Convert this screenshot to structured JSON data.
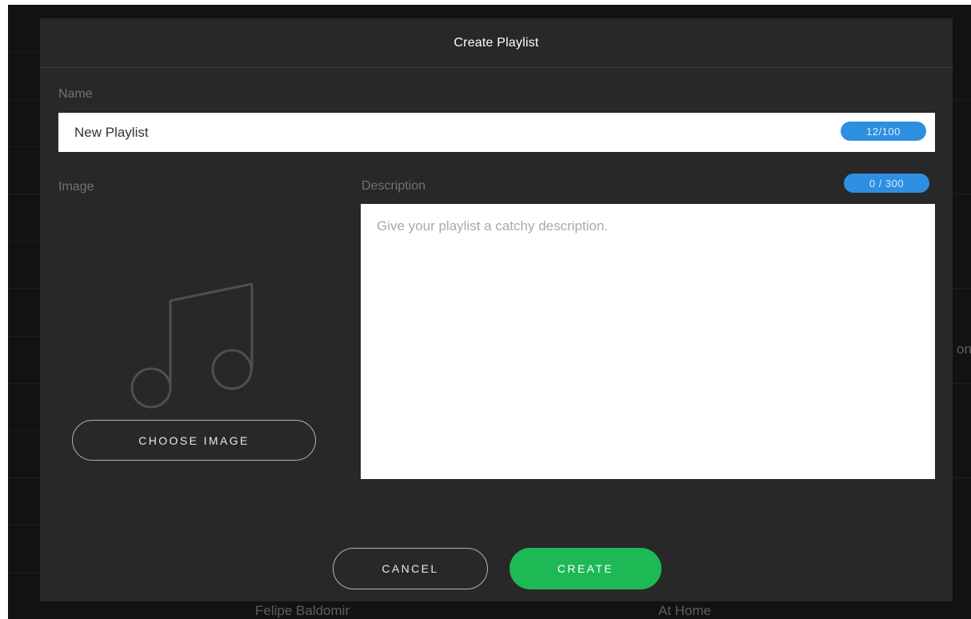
{
  "background": {
    "row_artist": "Felipe Baldomir",
    "row_album": "At Home",
    "edge_fragment": "on"
  },
  "dialog": {
    "title": "Create Playlist",
    "name": {
      "label": "Name",
      "value": "New Playlist",
      "counter": "12/100"
    },
    "image": {
      "label": "Image",
      "placeholder_icon": "music-note-icon",
      "choose_button": "CHOOSE IMAGE"
    },
    "description": {
      "label": "Description",
      "placeholder": "Give your playlist a catchy description.",
      "value": "",
      "counter": "0 / 300"
    },
    "actions": {
      "cancel": "CANCEL",
      "create": "CREATE"
    }
  },
  "colors": {
    "accent_green": "#1db954",
    "counter_blue": "#2e8fe0",
    "modal_background": "#282828",
    "app_background": "#121212"
  }
}
